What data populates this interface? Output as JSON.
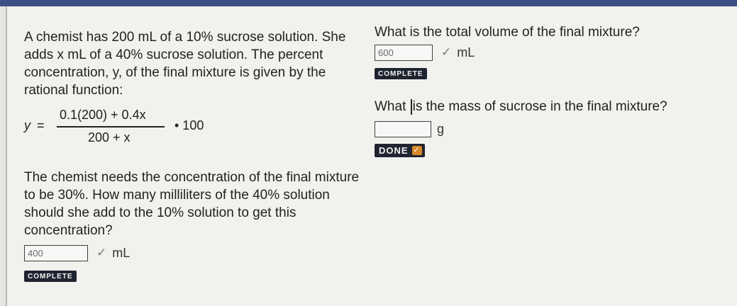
{
  "problem": {
    "text": "A chemist has 200 mL of a 10% sucrose solution. She adds x mL of a 40% sucrose solution. The percent concentration, y, of the final mixture is given by the rational function:",
    "formula": {
      "lhs": "y",
      "equals": "=",
      "numerator": "0.1(200) + 0.4x",
      "denominator": "200 + x",
      "multiplier": "• 100"
    }
  },
  "question1": {
    "text": "The chemist needs the concentration of the final mixture to be 30%. How many milliliters of the 40% solution should she add to the 10% solution to get this concentration?",
    "answer_value": "400",
    "check": "✓",
    "unit": "mL",
    "status": "COMPLETE"
  },
  "question2": {
    "text": "What is the total volume of the final mixture?",
    "answer_value": "600",
    "check": "✓",
    "unit": "mL",
    "status": "COMPLETE"
  },
  "question3": {
    "text_before": "What ",
    "text_after": "is the mass of sucrose in the final mixture?",
    "answer_value": "",
    "unit": "g",
    "status": "DONE"
  }
}
